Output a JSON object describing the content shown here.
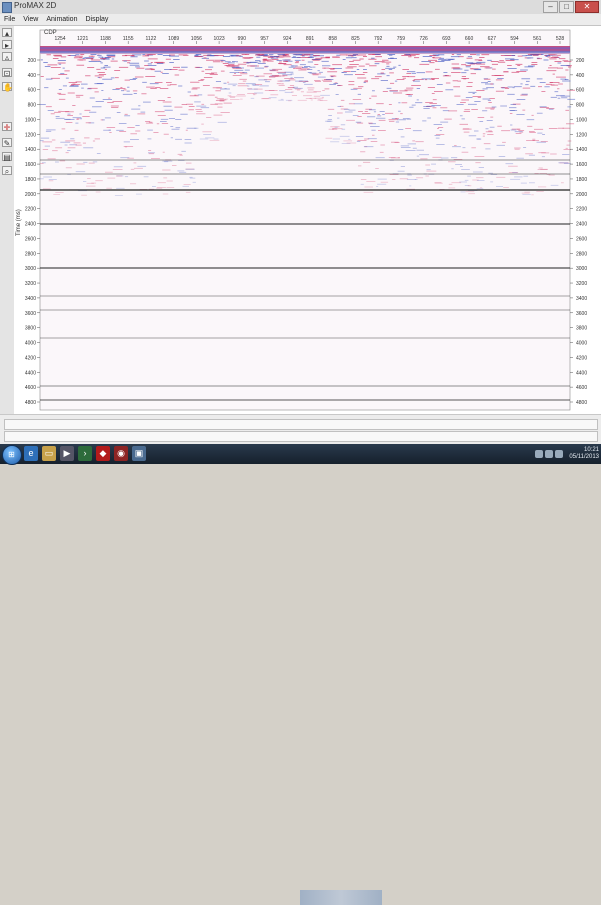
{
  "window": {
    "title": "ProMAX 2D"
  },
  "menu": [
    "File",
    "View",
    "Animation",
    "Display"
  ],
  "toolbar": {
    "icons": [
      "arrow-up-icon",
      "arrow-right-icon",
      "arrow-up-alt-icon",
      "zoom-icon",
      "hand-icon",
      "crosshair-icon",
      "pencil-icon",
      "palette-icon",
      "magnify-icon"
    ]
  },
  "panel": {
    "header": "CDP",
    "trace_labels": [
      "1254",
      "1221",
      "1188",
      "1155",
      "1122",
      "1089",
      "1056",
      "1023",
      "990",
      "957",
      "924",
      "891",
      "858",
      "825",
      "792",
      "759",
      "726",
      "693",
      "660",
      "627",
      "594",
      "561",
      "528"
    ],
    "time_labels": [
      "200",
      "400",
      "600",
      "800",
      "1000",
      "1200",
      "1400",
      "1600",
      "1800",
      "2000",
      "2200",
      "2400",
      "2600",
      "2800",
      "3000",
      "3200",
      "3400",
      "3600",
      "3800",
      "4000",
      "4200",
      "4400",
      "4600",
      "4800"
    ],
    "left_time_labels": [
      "200",
      "400",
      "600",
      "800",
      "1000",
      "1200",
      "1400",
      "1600",
      "1800",
      "2000",
      "2200",
      "2400",
      "2600",
      "2800",
      "3000",
      "3200",
      "3400",
      "3600",
      "3800",
      "4000",
      "4200",
      "4400",
      "4600",
      "4800"
    ],
    "y_axis_title": "Time (ms)"
  },
  "taskbar": {
    "time": "10:21",
    "date": "05/11/2013"
  }
}
